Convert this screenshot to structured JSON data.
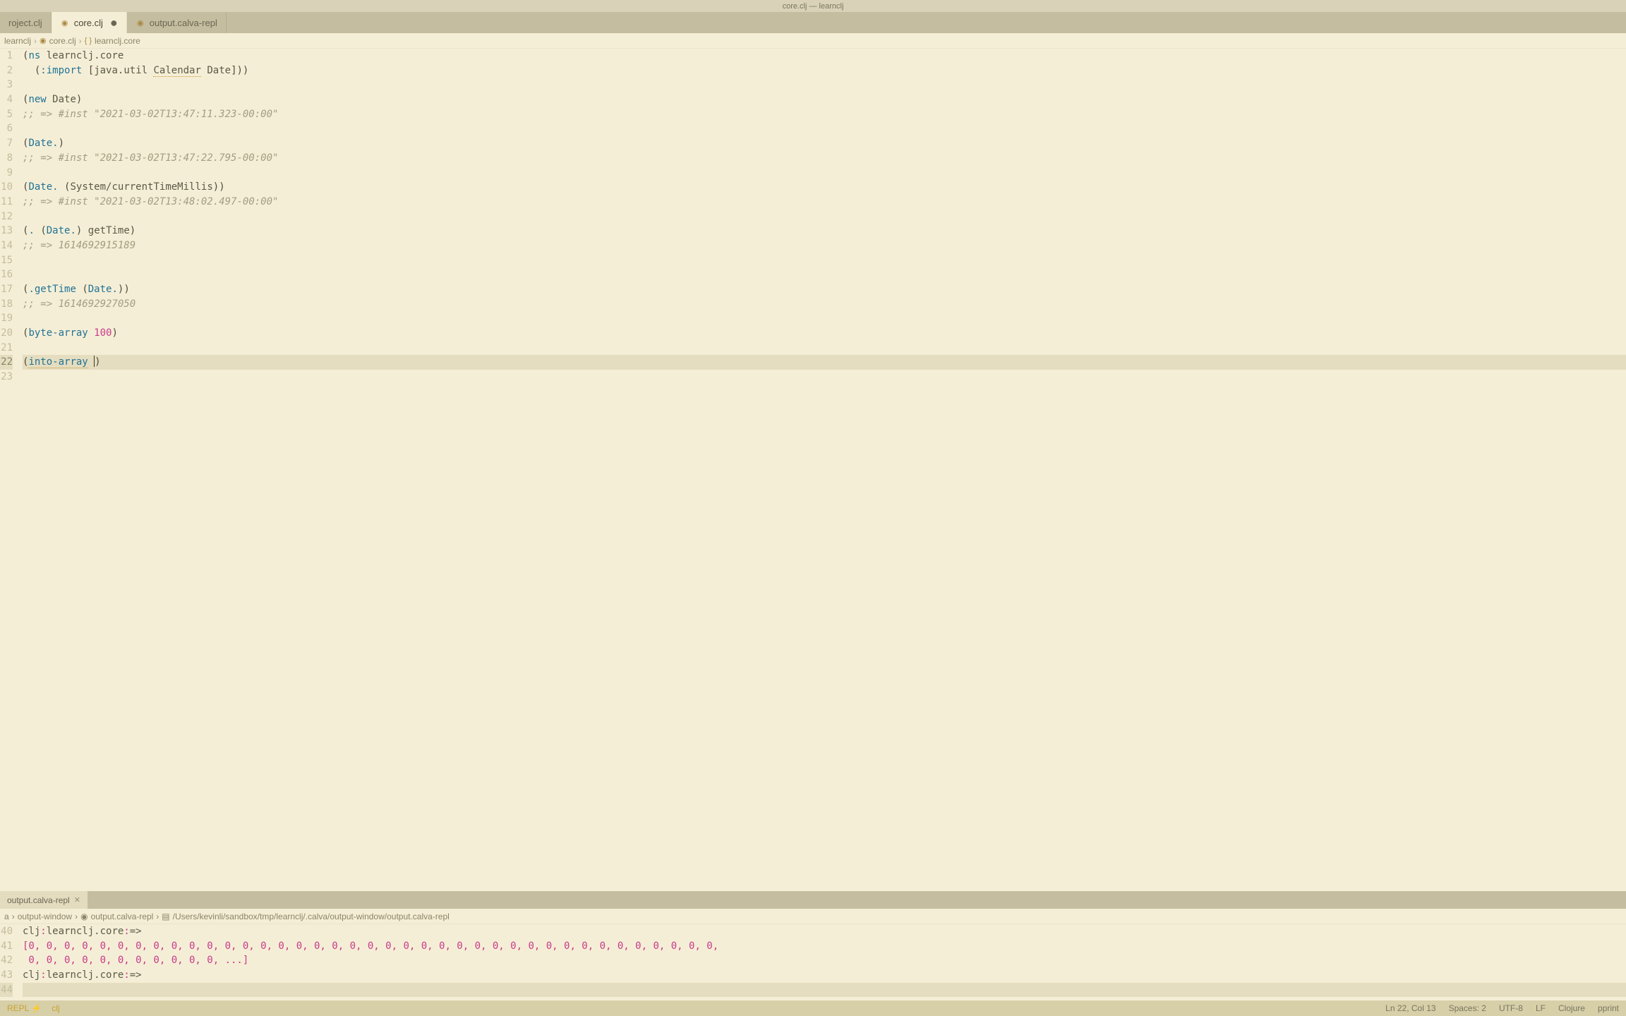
{
  "title_bar": "core.clj — learnclj",
  "tabs": [
    {
      "label": "roject.clj",
      "active": false,
      "dirty": false
    },
    {
      "label": "core.clj",
      "active": true,
      "dirty": true
    },
    {
      "label": "output.calva-repl",
      "active": false,
      "dirty": false
    }
  ],
  "breadcrumb": {
    "seg0": "learnclj",
    "seg1": "core.clj",
    "seg2": "learnclj.core"
  },
  "code": {
    "l1_ns": "ns",
    "l1_nsname": "learnclj.core",
    "l2_import": ":import",
    "l2_pkg": "java.util",
    "l2_cls1": "Calendar",
    "l2_cls2": "Date",
    "l4_new": "new",
    "l4_Date": "Date",
    "l5_comment": ";; => #inst \"2021-03-02T13:47:11.323-00:00\"",
    "l7_Date": "Date.",
    "l8_comment": ";; => #inst \"2021-03-02T13:47:22.795-00:00\"",
    "l10_Date": "Date.",
    "l10_call": "System/currentTimeMillis",
    "l11_comment": ";; => #inst \"2021-03-02T13:48:02.497-00:00\"",
    "l13_dot": ".",
    "l13_Date": "Date.",
    "l13_get": "getTime",
    "l14_comment": ";; => 1614692915189",
    "l17_get": ".getTime",
    "l17_Date": "Date.",
    "l18_comment": ";; => 1614692927050",
    "l20_fn": "byte-array",
    "l20_num": "100",
    "l22_fn": "into-array"
  },
  "line_numbers": [
    "1",
    "2",
    "3",
    "4",
    "5",
    "6",
    "7",
    "8",
    "9",
    "10",
    "11",
    "12",
    "13",
    "14",
    "15",
    "16",
    "17",
    "18",
    "19",
    "20",
    "21",
    "22",
    "23"
  ],
  "panel": {
    "tab_label": "output.calva-repl",
    "bc0": "a",
    "bc1": "output-window",
    "bc2": "output.calva-repl",
    "bc3": "/Users/kevinli/sandbox/tmp/learnclj/.calva/output-window/output.calva-repl",
    "line_numbers": [
      "40",
      "41",
      "42",
      "43",
      "44"
    ],
    "prompt_prefix": "clj",
    "prompt_ns": "learnclj.core",
    "prompt_suffix": "=>",
    "arr1": "[0, 0, 0, 0, 0, 0, 0, 0, 0, 0, 0, 0, 0, 0, 0, 0, 0, 0, 0, 0, 0, 0, 0, 0, 0, 0, 0, 0, 0, 0, 0, 0, 0, 0, 0, 0, 0, 0, 0,",
    "arr2": " 0, 0, 0, 0, 0, 0, 0, 0, 0, 0, 0, ...]"
  },
  "status": {
    "repl": "REPL",
    "clj": "clj",
    "pos": "Ln 22, Col 13",
    "spaces": "Spaces: 2",
    "encoding": "UTF-8",
    "eol": "LF",
    "lang": "Clojure",
    "pprint": "pprint"
  }
}
